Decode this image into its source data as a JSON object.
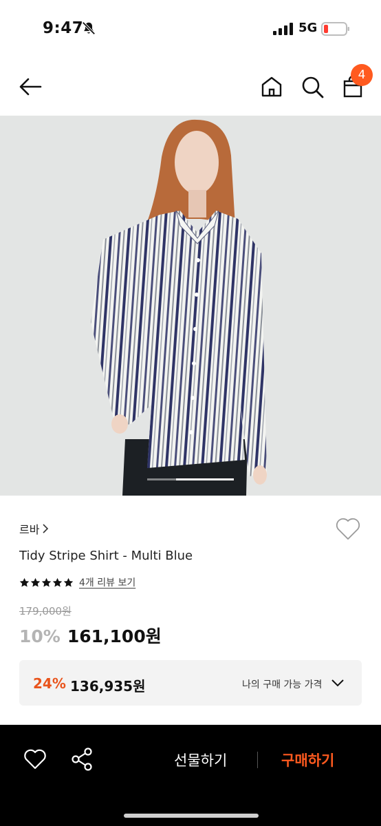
{
  "status_bar": {
    "time": "9:47",
    "network": "5G",
    "bell_icon": "bell-slash-icon",
    "signal_icon": "signal-bars-icon",
    "battery_icon": "battery-low-icon",
    "battery_color": "#ff3b30"
  },
  "nav": {
    "back_icon": "arrow-left-icon",
    "home_icon": "home-icon",
    "search_icon": "search-icon",
    "bag_icon": "shopping-bag-icon",
    "cart_count": "4",
    "badge_color": "#ff5a1f"
  },
  "gallery": {
    "current_slide_indicator": "slide-indicator",
    "image_description_icon": "model-wearing-striped-shirt-photo"
  },
  "product": {
    "brand": "르바",
    "brand_chevron": "chevron-right-icon",
    "name": "Tidy Stripe Shirt - Multi Blue",
    "rating_stars": 5,
    "review_link": "4개 리뷰 보기",
    "original_price": "179,000원",
    "discount": "10%",
    "sale_price": "161,100원",
    "wish_icon": "heart-outline-icon"
  },
  "best_price": {
    "discount": "24%",
    "price": "136,935원",
    "label": "나의 구매 가능 가격",
    "chevron_icon": "chevron-down-icon",
    "accent_color": "#e9541c"
  },
  "bottom_bar": {
    "heart_icon": "heart-outline-icon",
    "share_icon": "share-icon",
    "gift_label": "선물하기",
    "buy_label": "구매하기",
    "buy_color": "#ff5a1f"
  }
}
